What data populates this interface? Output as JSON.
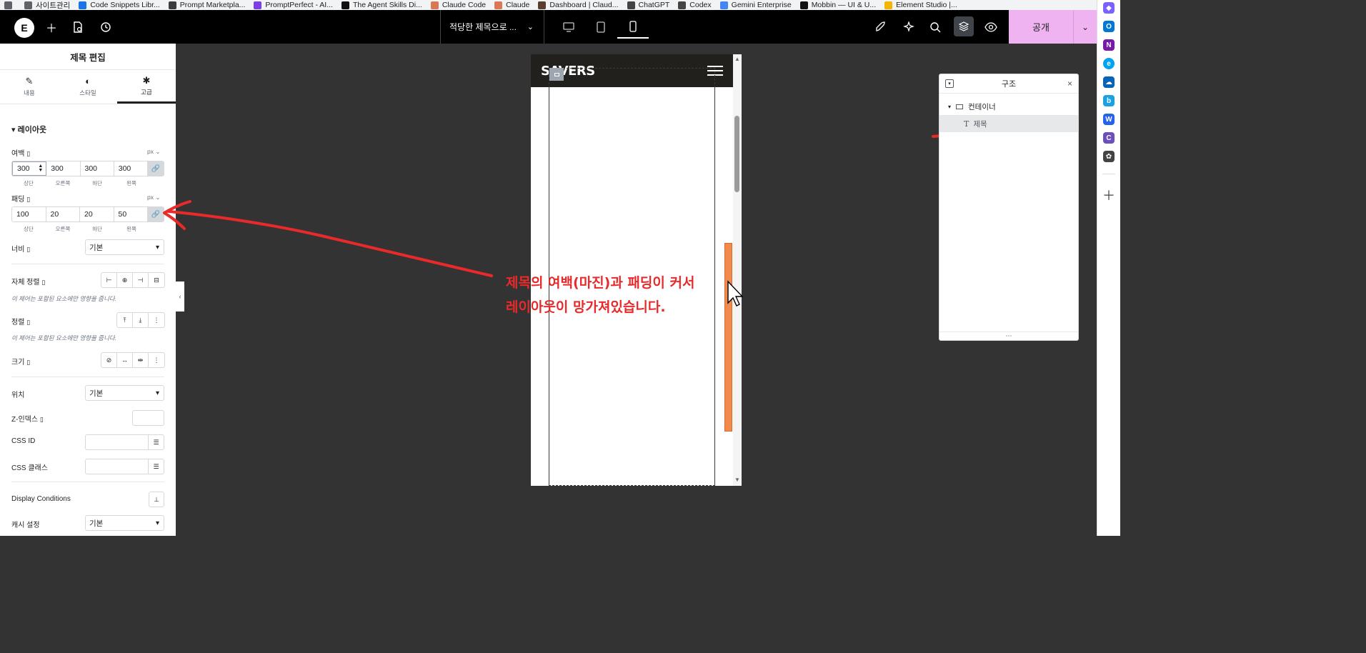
{
  "bookmarks": [
    {
      "label": "",
      "icon": "window-icon",
      "color": "#5f6368"
    },
    {
      "label": "사이트관리",
      "icon": "folder-icon",
      "color": "#5f6368"
    },
    {
      "label": "Code Snippets Libr...",
      "icon": "snippets-icon",
      "color": "#1a73e8"
    },
    {
      "label": "Prompt Marketpla...",
      "icon": "prompt-icon",
      "color": "#3c3c3c"
    },
    {
      "label": "PromptPerfect - AI...",
      "icon": "promptperfect-icon",
      "color": "#7b3fe4"
    },
    {
      "label": "The Agent Skills Di...",
      "icon": "agent-skills-icon",
      "color": "#111111"
    },
    {
      "label": "Claude Code",
      "icon": "claude-icon",
      "color": "#d97757"
    },
    {
      "label": "Claude",
      "icon": "claude-icon",
      "color": "#d97757"
    },
    {
      "label": "Dashboard | Claud...",
      "icon": "dashboard-icon",
      "color": "#5a3d2b"
    },
    {
      "label": "ChatGPT",
      "icon": "chatgpt-icon",
      "color": "#444444"
    },
    {
      "label": "Codex",
      "icon": "codex-icon",
      "color": "#444444"
    },
    {
      "label": "Gemini Enterprise",
      "icon": "gemini-icon",
      "color": "#4285f4"
    },
    {
      "label": "Mobbin — UI & U...",
      "icon": "mobbin-icon",
      "color": "#111111"
    },
    {
      "label": "Element Studio |...",
      "icon": "element-studio-icon",
      "color": "#f4b400"
    }
  ],
  "topbar": {
    "logo": "E",
    "doc_title": "적당한 제목으로 ...",
    "publish": "공개"
  },
  "panel": {
    "title": "제목 편집",
    "tabs": [
      {
        "label": "내용",
        "icon": "pencil-icon"
      },
      {
        "label": "스타일",
        "icon": "contrast-icon"
      },
      {
        "label": "고급",
        "icon": "gear-icon"
      }
    ],
    "section": "레이아웃",
    "margin": {
      "label": "여백",
      "unit": "px",
      "values": [
        "300",
        "300",
        "300",
        "300"
      ],
      "sides": [
        "상단",
        "오른쪽",
        "하단",
        "왼쪽"
      ]
    },
    "padding": {
      "label": "패딩",
      "unit": "px",
      "values": [
        "100",
        "20",
        "20",
        "50"
      ],
      "sides": [
        "상단",
        "오른쪽",
        "하단",
        "왼쪽"
      ]
    },
    "width": {
      "label": "너비",
      "value": "기본"
    },
    "self_align": {
      "label": "자체 정렬",
      "note": "이 제어는 포함된 요소에만 영향을 줍니다."
    },
    "order": {
      "label": "정렬",
      "note": "이 제어는 포함된 요소에만 영향을 줍니다."
    },
    "size": {
      "label": "크기"
    },
    "position": {
      "label": "위치",
      "value": "기본"
    },
    "z_index": {
      "label": "Z-인덱스"
    },
    "css_id": {
      "label": "CSS ID"
    },
    "css_class": {
      "label": "CSS 클래스"
    },
    "display_conditions": {
      "label": "Display Conditions"
    },
    "cache": {
      "label": "캐시 설정",
      "value": "기본"
    }
  },
  "canvas": {
    "brand": "SAVERS"
  },
  "annotation": {
    "line1": "제목의 여백(마진)과 패딩이 커서",
    "line2": "레이아웃이 망가져있습니다.",
    "color": "#e82a2a"
  },
  "structure": {
    "title": "구조",
    "container": "컨테이너",
    "heading": "제목"
  }
}
